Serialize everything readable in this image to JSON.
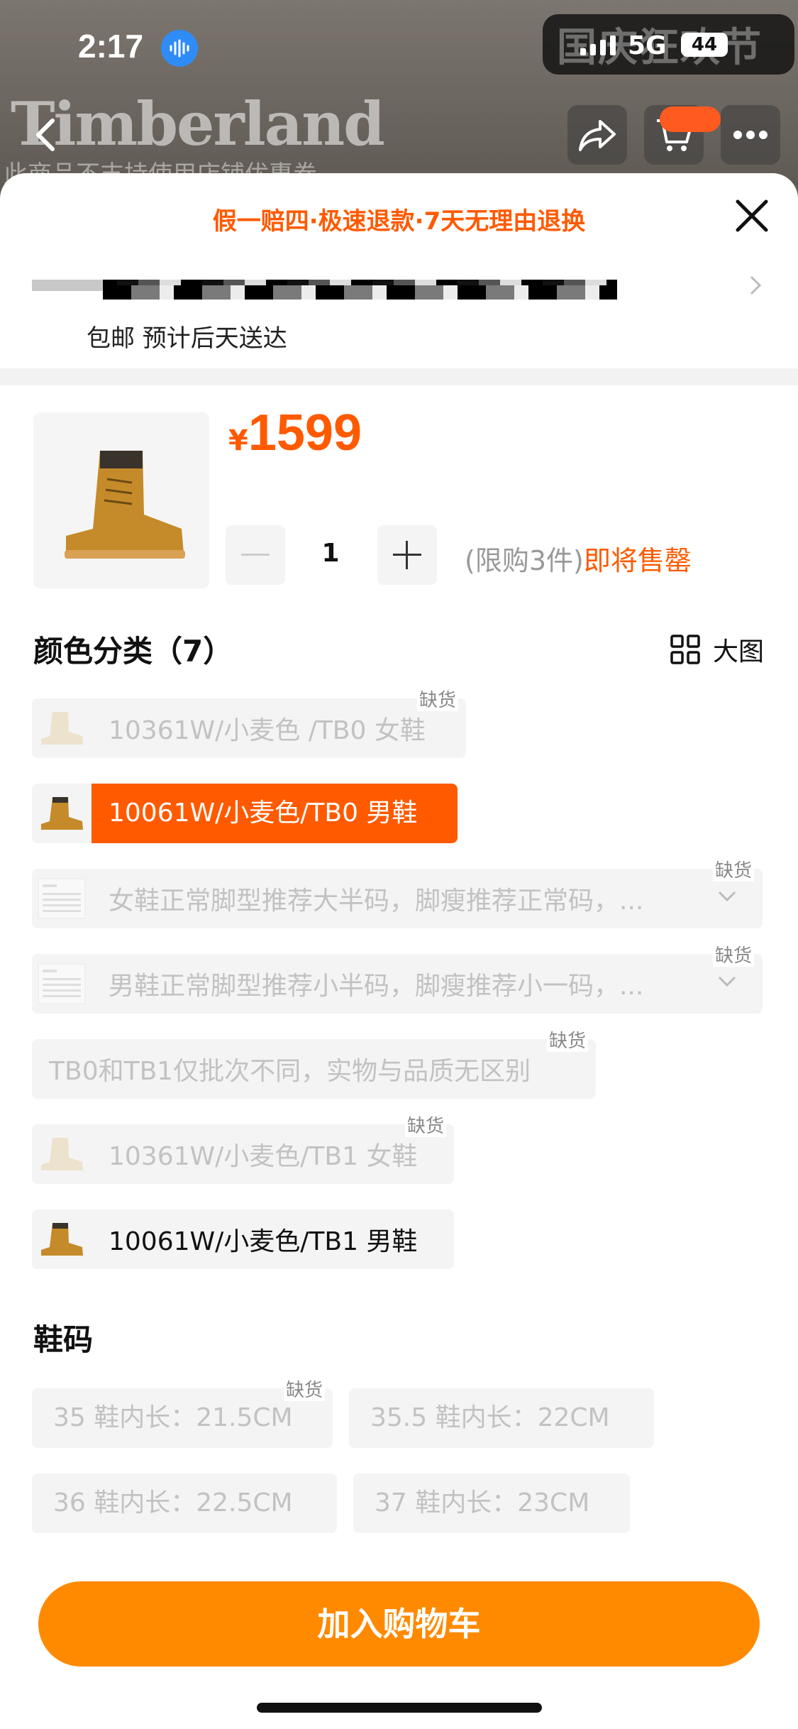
{
  "status_bar": {
    "time": "2:17",
    "network": "5G",
    "battery": "44"
  },
  "background_page": {
    "brand": "Timberland",
    "notice": "此商品不支持使用店铺优惠券",
    "festival": "国庆狂欢节"
  },
  "sheet": {
    "promo": "假一赔四·极速退款·7天无理由退换",
    "delivery": "包邮 预计后天送达"
  },
  "product": {
    "currency": "¥",
    "price": "1599",
    "quantity": "1",
    "limit_text": "(限购3件)",
    "stock_text": "即将售罄"
  },
  "colors": {
    "title": "颜色分类（7）",
    "big_view_label": "大图",
    "out_of_stock": "缺货",
    "options": [
      {
        "label": "10361W/小麦色 /TB0 女鞋",
        "state": "disabled"
      },
      {
        "label": "10061W/小麦色/TB0 男鞋",
        "state": "selected"
      },
      {
        "label": "女鞋正常脚型推荐大半码，脚瘦推荐正常码，...",
        "state": "disabled"
      },
      {
        "label": "男鞋正常脚型推荐小半码，脚瘦推荐小一码，...",
        "state": "disabled"
      },
      {
        "label": "TB0和TB1仅批次不同，实物与品质无区别",
        "state": "disabled"
      },
      {
        "label": "10361W/小麦色/TB1 女鞋",
        "state": "disabled"
      },
      {
        "label": "10061W/小麦色/TB1 男鞋",
        "state": "available"
      }
    ]
  },
  "sizes": {
    "title": "鞋码",
    "options": [
      {
        "label": "35 鞋内长：21.5CM",
        "state": "disabled"
      },
      {
        "label": "35.5 鞋内长：22CM",
        "state": "disabled"
      },
      {
        "label": "36 鞋内长：22.5CM",
        "state": "disabled"
      },
      {
        "label": "37 鞋内长：23CM",
        "state": "disabled"
      }
    ]
  },
  "actions": {
    "add_to_cart": "加入购物车"
  },
  "theme": {
    "accent": "#ff5a00",
    "button": "#ff8a00"
  }
}
